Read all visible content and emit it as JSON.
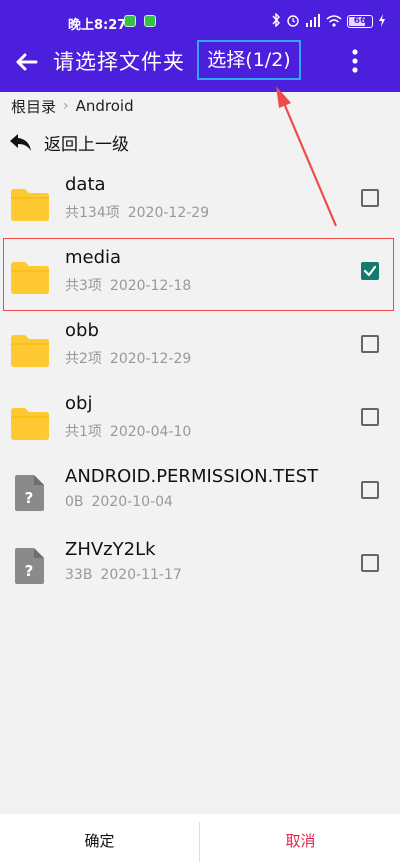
{
  "status_bar": {
    "time": "晚上8:27",
    "battery": "66"
  },
  "toolbar": {
    "title": "请选择文件夹",
    "selection_count": "选择(1/2)"
  },
  "breadcrumb": {
    "root": "根目录",
    "current": "Android"
  },
  "go_up_label": "返回上一级",
  "items": [
    {
      "name": "data",
      "count": "共134项",
      "date": "2020-12-29",
      "type": "folder",
      "checked": false
    },
    {
      "name": "media",
      "count": "共3项",
      "date": "2020-12-18",
      "type": "folder",
      "checked": true
    },
    {
      "name": "obb",
      "count": "共2项",
      "date": "2020-12-29",
      "type": "folder",
      "checked": false
    },
    {
      "name": "obj",
      "count": "共1项",
      "date": "2020-04-10",
      "type": "folder",
      "checked": false
    },
    {
      "name": "ANDROID.PERMISSION.TEST",
      "count": "0B",
      "date": "2020-10-04",
      "type": "unknown-file",
      "checked": false
    },
    {
      "name": "ZHVzY2Lk",
      "count": "33B",
      "date": "2020-11-17",
      "type": "unknown-file",
      "checked": false
    }
  ],
  "bottom_bar": {
    "confirm_label": "确定",
    "cancel_label": "取消"
  },
  "colors": {
    "header": "#4b1fdb",
    "folder": "#ffc933",
    "checkbox_checked": "#137a6e",
    "cancel": "#e0284f",
    "annotation": "#ee4b4b"
  }
}
